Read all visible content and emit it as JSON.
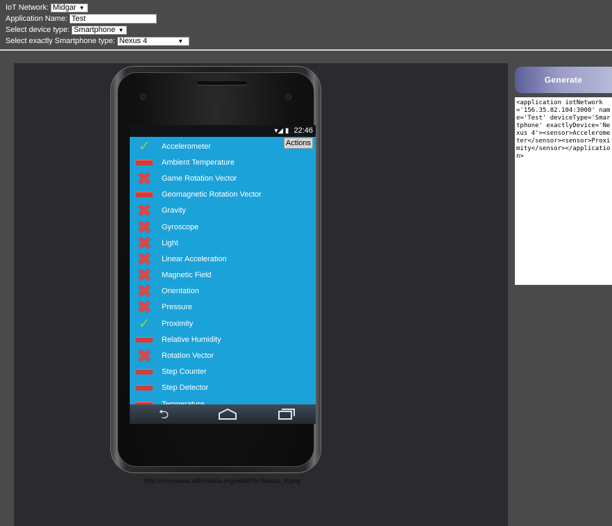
{
  "form": {
    "network_label": "IoT Network:",
    "network_value": "Midgar",
    "app_name_label": "Application Name:",
    "app_name_value": "Test",
    "device_type_label": "Select device type:",
    "device_type_value": "Smartphone",
    "exact_label": "Select exactly Smartphone type:",
    "exact_value": "Nexus 4",
    "dropdown_arrow": "▼"
  },
  "phone": {
    "status_time": "22:46",
    "status_icons": "▾◢ ▮",
    "actions_label": "Actions",
    "sensors": [
      {
        "label": "Accelerometer",
        "state": "check"
      },
      {
        "label": "Ambient Temperature",
        "state": "dash"
      },
      {
        "label": "Game Rotation Vector",
        "state": "x"
      },
      {
        "label": "Geomagnetic Rotation Vector",
        "state": "dash"
      },
      {
        "label": "Gravity",
        "state": "x"
      },
      {
        "label": "Gyroscope",
        "state": "x"
      },
      {
        "label": "Light",
        "state": "x"
      },
      {
        "label": "Linear Acceleration",
        "state": "x"
      },
      {
        "label": "Magnetic Field",
        "state": "x"
      },
      {
        "label": "Orientation",
        "state": "x"
      },
      {
        "label": "Pressure",
        "state": "x"
      },
      {
        "label": "Proximity",
        "state": "check"
      },
      {
        "label": "Relative Humidity",
        "state": "dash"
      },
      {
        "label": "Rotation Vector",
        "state": "x"
      },
      {
        "label": "Step Counter",
        "state": "dash"
      },
      {
        "label": "Step Detector",
        "state": "dash"
      },
      {
        "label": "Temperature",
        "state": "dash"
      }
    ],
    "nav_back_glyph": "⮌",
    "credit": "http://commons.wikimedia.org/wiki/File:Nexus_4.png"
  },
  "generate": {
    "button_label": "Generate",
    "output": "<application iotNetwork='156.35.82.104:3000' name='Test' deviceType='Smartphone' exactlyDevice='Nexus 4'><sensor>Accelerometer</sensor><sensor>Proximity</sensor></application>"
  },
  "colors": {
    "screen_bg": "#1ba2d9",
    "check": "#8ed13e",
    "cross": "#e04646",
    "dash": "#d23c3c"
  }
}
